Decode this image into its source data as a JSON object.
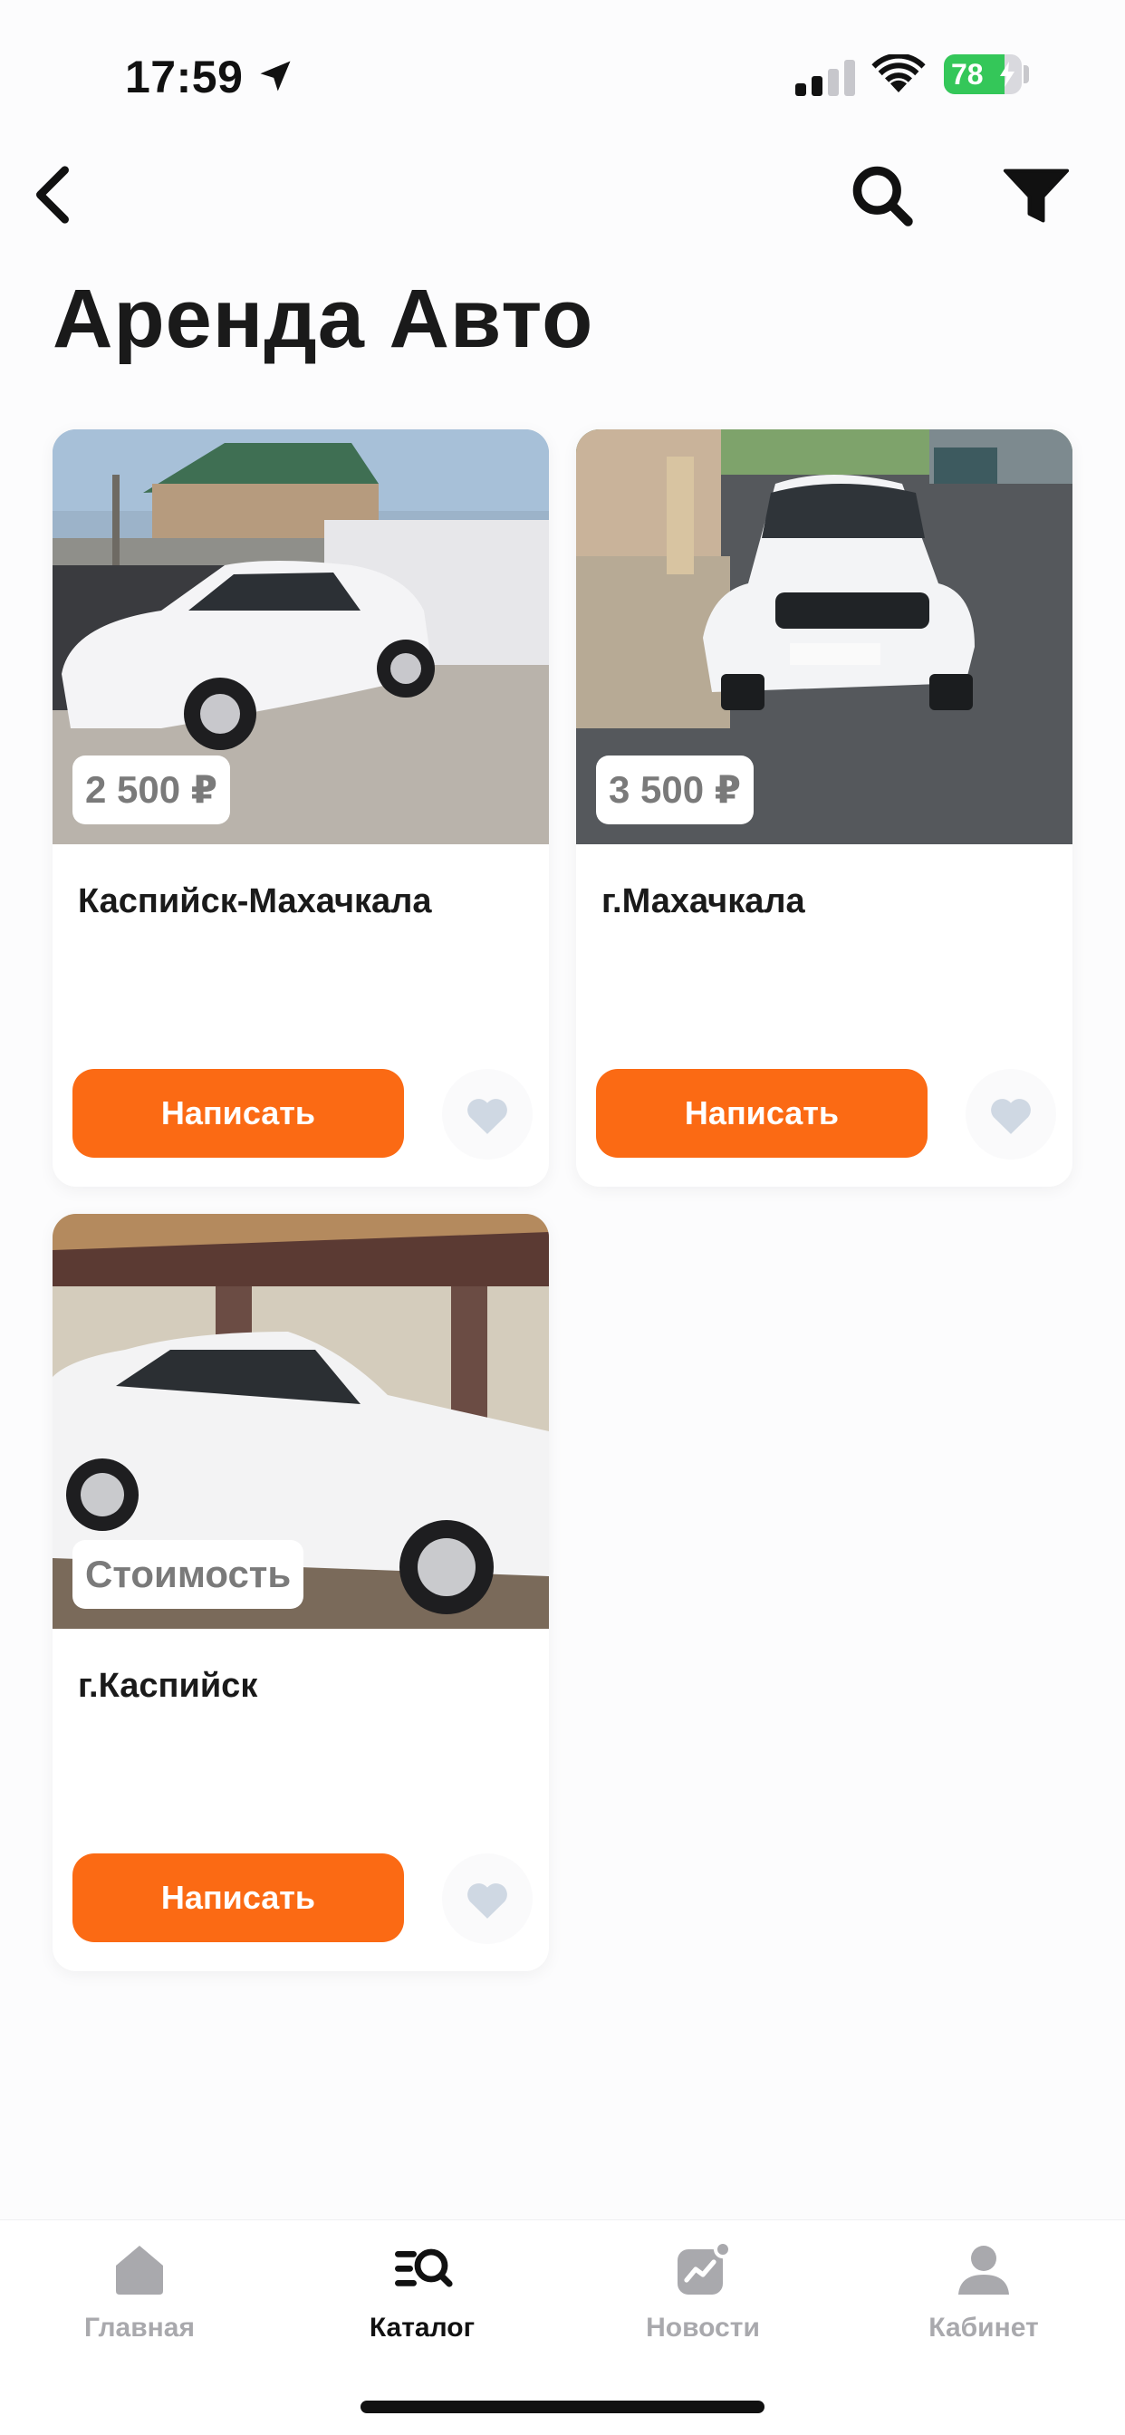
{
  "status_bar": {
    "time": "17:59",
    "battery": "78",
    "battery_level": 0.78,
    "icons": [
      "location-arrow-icon",
      "signal-icon",
      "wifi-icon",
      "battery-icon"
    ]
  },
  "nav": {
    "back_icon": "chevron-left-icon",
    "search_icon": "search-icon",
    "filter_icon": "filter-icon"
  },
  "page": {
    "title": "Аренда Авто"
  },
  "listings": [
    {
      "price": "2 500 ₽",
      "city": "Каспийск-Махачкала",
      "button": "Написать",
      "favorite_icon": "heart-icon"
    },
    {
      "price": "3 500 ₽",
      "city": "г.Махачкала",
      "button": "Написать",
      "favorite_icon": "heart-icon"
    },
    {
      "price": "Стоимость",
      "city": "г.Каспийск",
      "button": "Написать",
      "favorite_icon": "heart-icon"
    }
  ],
  "tabs": [
    {
      "label": "Главная",
      "icon": "home-icon",
      "active": false
    },
    {
      "label": "Каталог",
      "icon": "catalog-search-icon",
      "active": true
    },
    {
      "label": "Новости",
      "icon": "news-chart-icon",
      "active": false
    },
    {
      "label": "Кабинет",
      "icon": "profile-icon",
      "active": false
    }
  ],
  "colors": {
    "accent": "#fb6a14",
    "favorite": "#cfd8e3",
    "tab_active": "#111111",
    "tab_inactive": "#a9a9ad",
    "battery": "#34c759"
  }
}
